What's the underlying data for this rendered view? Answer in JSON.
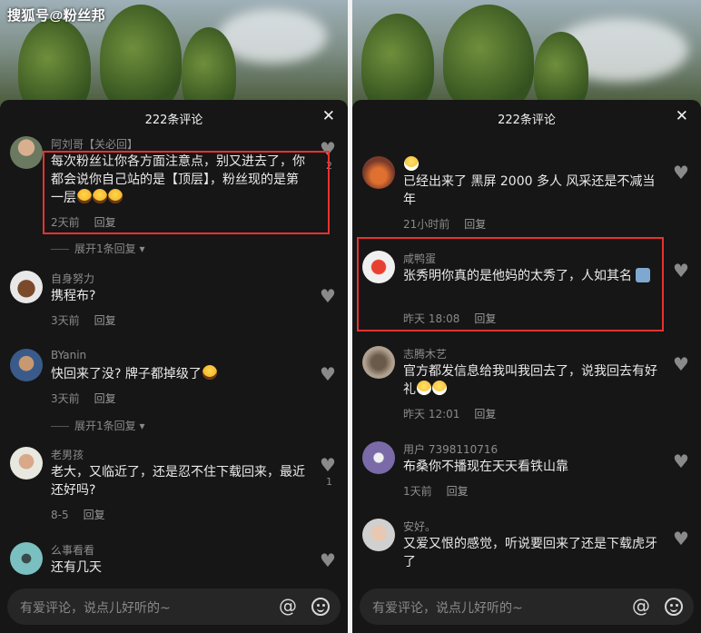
{
  "watermark": "搜狐号@粉丝邦",
  "colors": {
    "sheet_bg": "#161616",
    "highlight": "#e8322f",
    "text_muted": "#8a8a8a",
    "divider": "#f2f2f2"
  },
  "left": {
    "title": "222条评论",
    "close": "✕",
    "comments": [
      {
        "name": "阿刘哥【关必回】",
        "text": "每次粉丝让你各方面注意点，别又进去了，你都会说你自己站的是【顶层】，粉丝现的是第一层",
        "emoji": "laugh-cry-x3",
        "time": "2天前",
        "reply": "回复",
        "likes": "2"
      },
      {
        "name": "自身努力",
        "text": "携程布?",
        "time": "3天前",
        "reply": "回复"
      },
      {
        "name": "BYanin",
        "text": "快回来了没? 牌子都掉级了",
        "emoji": "laugh-cry",
        "time": "3天前",
        "reply": "回复"
      },
      {
        "name": "老男孩",
        "text": "老大，又临近了，还是忍不住下载回来，最近还好吗?",
        "time": "8-5",
        "reply": "回复",
        "likes": "1"
      },
      {
        "name": "么事看看",
        "text": "还有几天"
      }
    ],
    "expand_1": "展开1条回复",
    "expand_2": "展开1条回复"
  },
  "right": {
    "title": "222条评论",
    "close": "✕",
    "comments": [
      {
        "name": "",
        "emoji_top": "grin",
        "text": "已经出来了 黑屏 2000 多人 风采还是不减当年",
        "time": "21小时前",
        "reply": "回复"
      },
      {
        "name": "咸鸭蛋",
        "text": "张秀明你真的是他妈的太秀了，人如其名",
        "emoji": "cat",
        "time": "昨天 18:08",
        "reply": "回复"
      },
      {
        "name": "志腾木艺",
        "text": "官方都发信息给我叫我回去了，说我回去有好礼",
        "emoji": "grin-x2",
        "time": "昨天 12:01",
        "reply": "回复"
      },
      {
        "name": "用户 7398110716",
        "text": "布桑你不播现在天天看铁山靠",
        "time": "1天前",
        "reply": "回复"
      },
      {
        "name": "安好。",
        "text": "又爱又恨的感觉，听说要回来了还是下载虎牙了"
      }
    ]
  },
  "input": {
    "placeholder": "有爱评论，说点儿好听的~",
    "at": "@"
  }
}
